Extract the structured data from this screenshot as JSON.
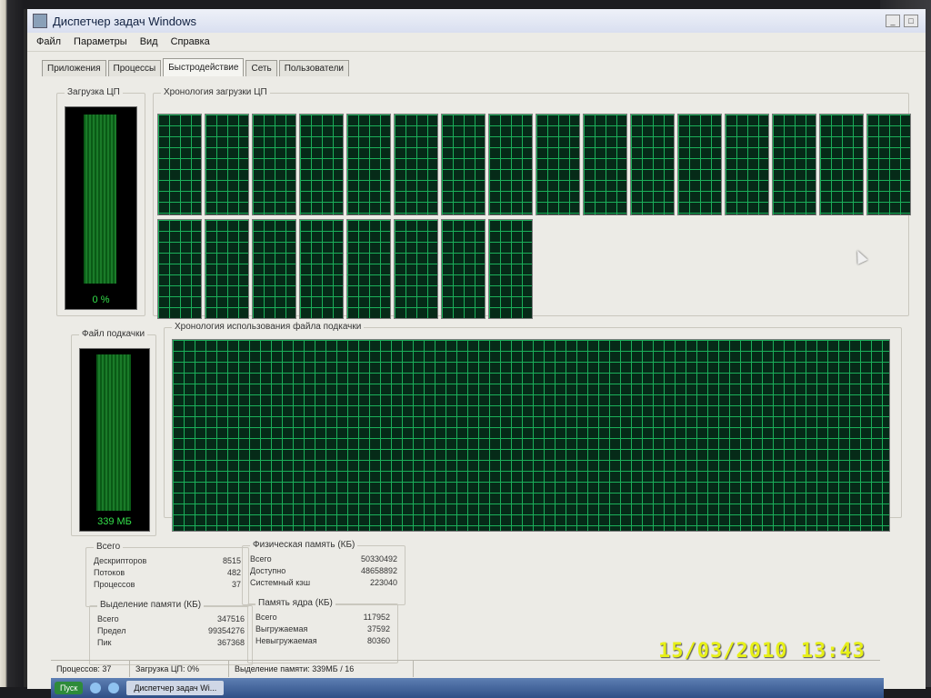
{
  "window": {
    "title": "Диспетчер задач Windows"
  },
  "menu": [
    "Файл",
    "Параметры",
    "Вид",
    "Справка"
  ],
  "tabs": [
    {
      "label": "Приложения"
    },
    {
      "label": "Процессы"
    },
    {
      "label": "Быстродействие",
      "active": true
    },
    {
      "label": "Сеть"
    },
    {
      "label": "Пользователи"
    }
  ],
  "cpu_usage": {
    "label": "Загрузка ЦП",
    "value": "0 %",
    "percent": 0
  },
  "cpu_history": {
    "label": "Хронология загрузки ЦП",
    "cores": 24
  },
  "pagefile_usage": {
    "label": "Файл подкачки",
    "value": "339 МБ"
  },
  "pagefile_history": {
    "label": "Хронология использования файла подкачки"
  },
  "totals": {
    "label": "Всего",
    "rows": [
      {
        "name": "Дескрипторов",
        "value": "8515"
      },
      {
        "name": "Потоков",
        "value": "482"
      },
      {
        "name": "Процессов",
        "value": "37"
      }
    ]
  },
  "physical_memory": {
    "label": "Физическая память (КБ)",
    "rows": [
      {
        "name": "Всего",
        "value": "50330492"
      },
      {
        "name": "Доступно",
        "value": "48658892"
      },
      {
        "name": "Системный кэш",
        "value": "223040"
      }
    ]
  },
  "commit_charge": {
    "label": "Выделение памяти (КБ)",
    "rows": [
      {
        "name": "Всего",
        "value": "347516"
      },
      {
        "name": "Предел",
        "value": "99354276"
      },
      {
        "name": "Пик",
        "value": "367368"
      }
    ]
  },
  "kernel_memory": {
    "label": "Память ядра (КБ)",
    "rows": [
      {
        "name": "Всего",
        "value": "117952"
      },
      {
        "name": "Выгружаемая",
        "value": "37592"
      },
      {
        "name": "Невыгружаемая",
        "value": "80360"
      }
    ]
  },
  "statusbar": {
    "processes": "Процессов: 37",
    "cpu": "Загрузка ЦП: 0%",
    "commit": "Выделение памяти: 339МБ / 16"
  },
  "taskbar": {
    "start": "Пуск",
    "task": "Диспетчер задач Wi..."
  },
  "photo_datestamp": "15/03/2010 13:43",
  "colors": {
    "graph_bg": "#062a18",
    "graph_grid": "#1bb05a",
    "meter_text": "#33e04a",
    "datestamp": "#e7f018"
  }
}
